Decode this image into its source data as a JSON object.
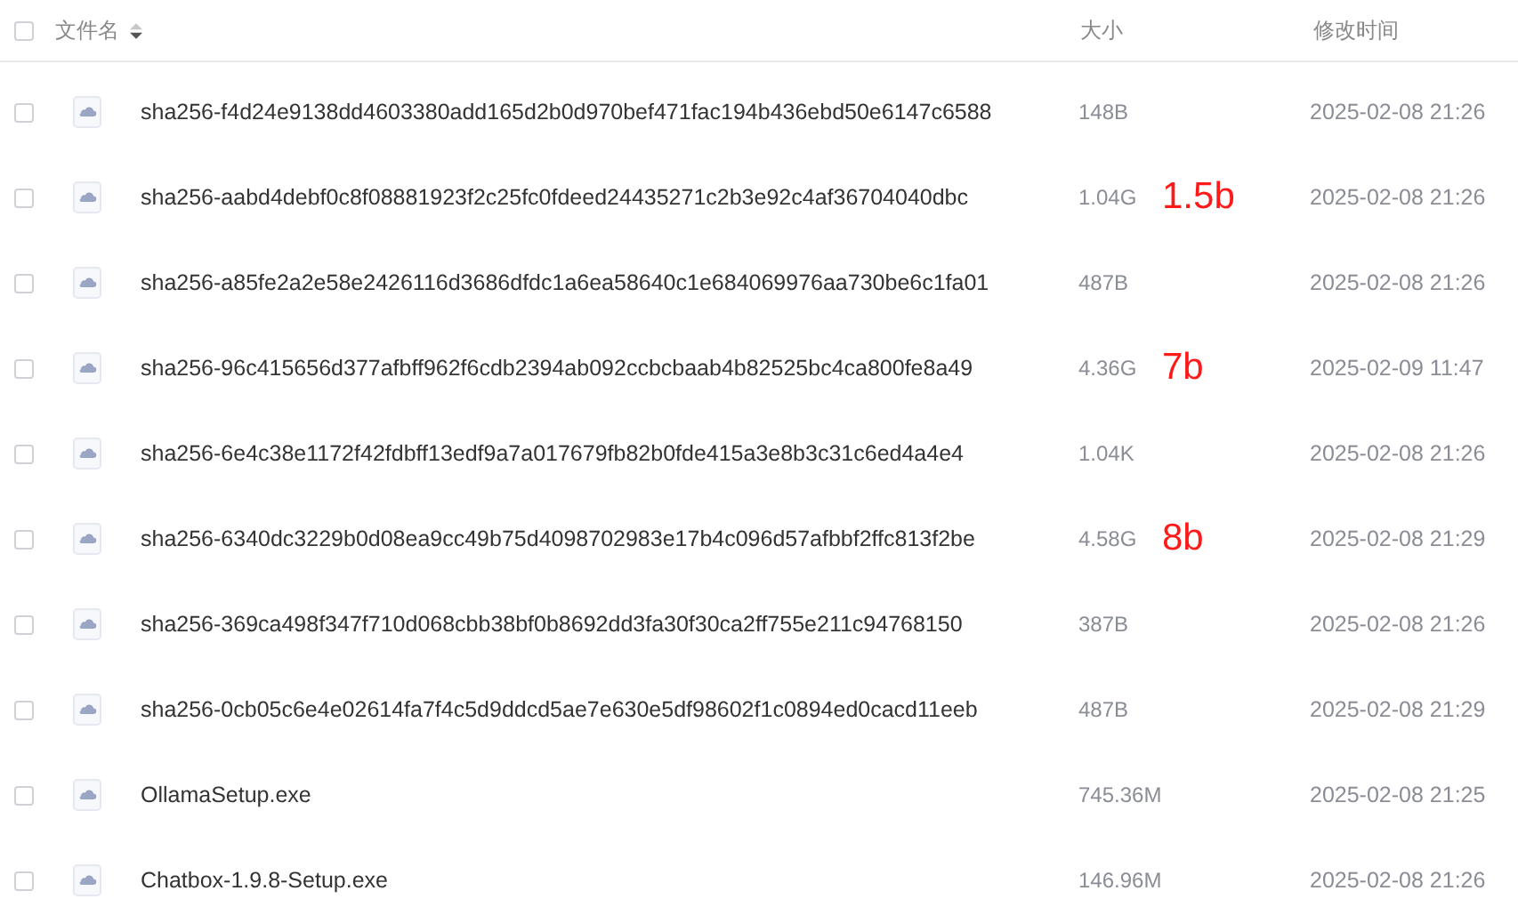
{
  "header": {
    "select_all": {
      "checked": false
    },
    "columns": [
      {
        "label": "文件名",
        "sortable": true
      },
      {
        "label": "大小",
        "sortable": false
      },
      {
        "label": "修改时间",
        "sortable": false
      }
    ]
  },
  "rows": [
    {
      "name": "sha256-f4d24e9138dd4603380add165d2b0d970bef471fac194b436ebd50e6147c6588",
      "size": "148B",
      "modified": "2025-02-08 21:26",
      "checked": false
    },
    {
      "name": "sha256-aabd4debf0c8f08881923f2c25fc0fdeed24435271c2b3e92c4af36704040dbc",
      "size": "1.04G",
      "note": "1.5b",
      "modified": "2025-02-08 21:26",
      "checked": false
    },
    {
      "name": "sha256-a85fe2a2e58e2426116d3686dfdc1a6ea58640c1e684069976aa730be6c1fa01",
      "size": "487B",
      "modified": "2025-02-08 21:26",
      "checked": false
    },
    {
      "name": "sha256-96c415656d377afbff962f6cdb2394ab092ccbcbaab4b82525bc4ca800fe8a49",
      "size": "4.36G",
      "note": "7b",
      "modified": "2025-02-09 11:47",
      "checked": false
    },
    {
      "name": "sha256-6e4c38e1172f42fdbff13edf9a7a017679fb82b0fde415a3e8b3c31c6ed4a4e4",
      "size": "1.04K",
      "modified": "2025-02-08 21:26",
      "checked": false
    },
    {
      "name": "sha256-6340dc3229b0d08ea9cc49b75d4098702983e17b4c096d57afbbf2ffc813f2be",
      "size": "4.58G",
      "note": "8b",
      "modified": "2025-02-08 21:29",
      "checked": false
    },
    {
      "name": "sha256-369ca498f347f710d068cbb38bf0b8692dd3fa30f30ca2ff755e211c94768150",
      "size": "387B",
      "modified": "2025-02-08 21:26",
      "checked": false
    },
    {
      "name": "sha256-0cb05c6e4e02614fa7f4c5d9ddcd5ae7e630e5df98602f1c0894ed0cacd11eeb",
      "size": "487B",
      "modified": "2025-02-08 21:29",
      "checked": false
    },
    {
      "name": "OllamaSetup.exe",
      "size": "745.36M",
      "modified": "2025-02-08 21:25",
      "checked": false
    },
    {
      "name": "Chatbox-1.9.8-Setup.exe",
      "size": "146.96M",
      "modified": "2025-02-08 21:26",
      "checked": false
    }
  ]
}
